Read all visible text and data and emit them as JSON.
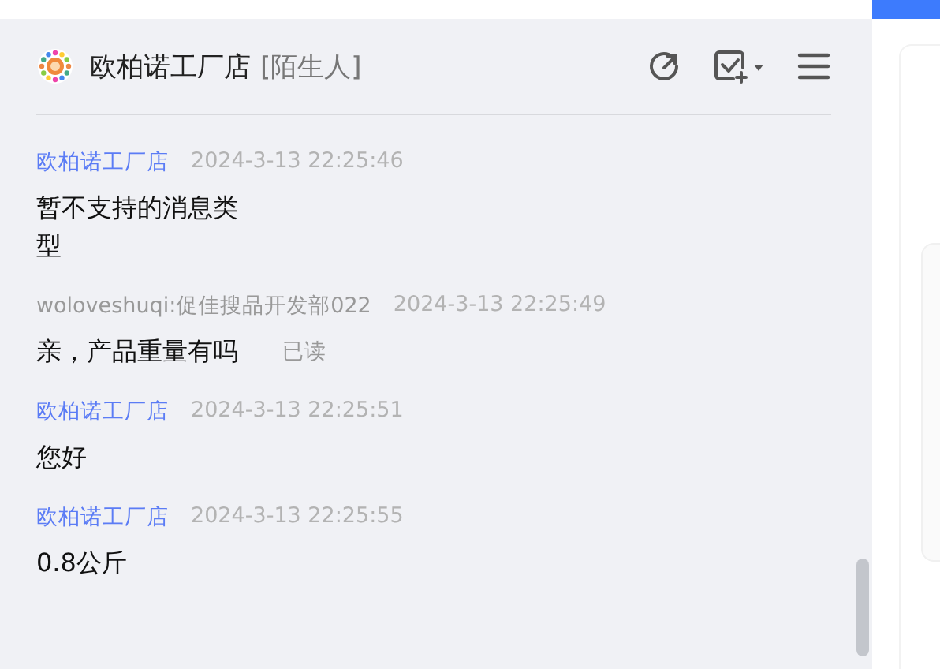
{
  "header": {
    "title": "欧柏诺工厂店",
    "tag": "[陌生人]"
  },
  "messages": [
    {
      "sender": "欧柏诺工厂店",
      "from_shop": true,
      "time": "2024-3-13 22:25:46",
      "text": "暂不支持的消息类型"
    },
    {
      "sender": "woloveshuqi:促佳搜品开发部022",
      "from_shop": false,
      "time": "2024-3-13 22:25:49",
      "text": "亲，产品重量有吗",
      "status": "已读"
    },
    {
      "sender": "欧柏诺工厂店",
      "from_shop": true,
      "time": "2024-3-13 22:25:51",
      "text": "您好"
    },
    {
      "sender": "欧柏诺工厂店",
      "from_shop": true,
      "time": "2024-3-13 22:25:55",
      "text": "0.8公斤"
    }
  ]
}
